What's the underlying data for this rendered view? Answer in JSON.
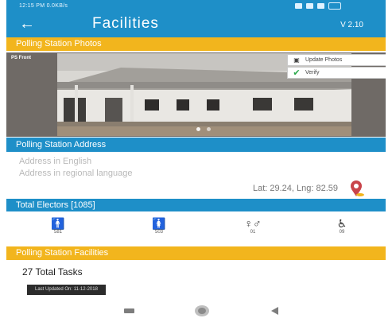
{
  "status_bar": {
    "time_speed": "12:15 PM  0.0KB/s"
  },
  "app_bar": {
    "back_icon": "back-arrow-icon",
    "title": "Facilities",
    "version": "V 2.10"
  },
  "photos_section": {
    "header": "Polling Station Photos",
    "photo_tag": "PS Front",
    "update_photos_label": "Update Photos",
    "verify_label": "Verify",
    "carousel_dots": 2
  },
  "address_section": {
    "header": "Polling Station Address",
    "address_english": "Address in English",
    "address_regional": "Address in regional language",
    "lat_lng": "Lat: 29.24, Lng: 82.59"
  },
  "electors_section": {
    "header": "Total Electors [1085]",
    "categories": [
      {
        "icon": "male-voter-icon",
        "glyph": "🚹",
        "count": "581"
      },
      {
        "icon": "female-voter-icon",
        "glyph": "🚺",
        "count": "503"
      },
      {
        "icon": "third-gender-icon",
        "glyph": "♀♂",
        "count": "01"
      },
      {
        "icon": "wheelchair-icon",
        "glyph": "♿",
        "count": "09"
      }
    ]
  },
  "facilities_section": {
    "header": "Polling Station Facilities",
    "tasks_label": "27 Total Tasks",
    "last_updated": "Last Updated On: 11-12-2018"
  },
  "colors": {
    "primary_blue": "#1e8fc8",
    "accent_yellow": "#f2b51d",
    "verify_green": "#2aa84a"
  }
}
